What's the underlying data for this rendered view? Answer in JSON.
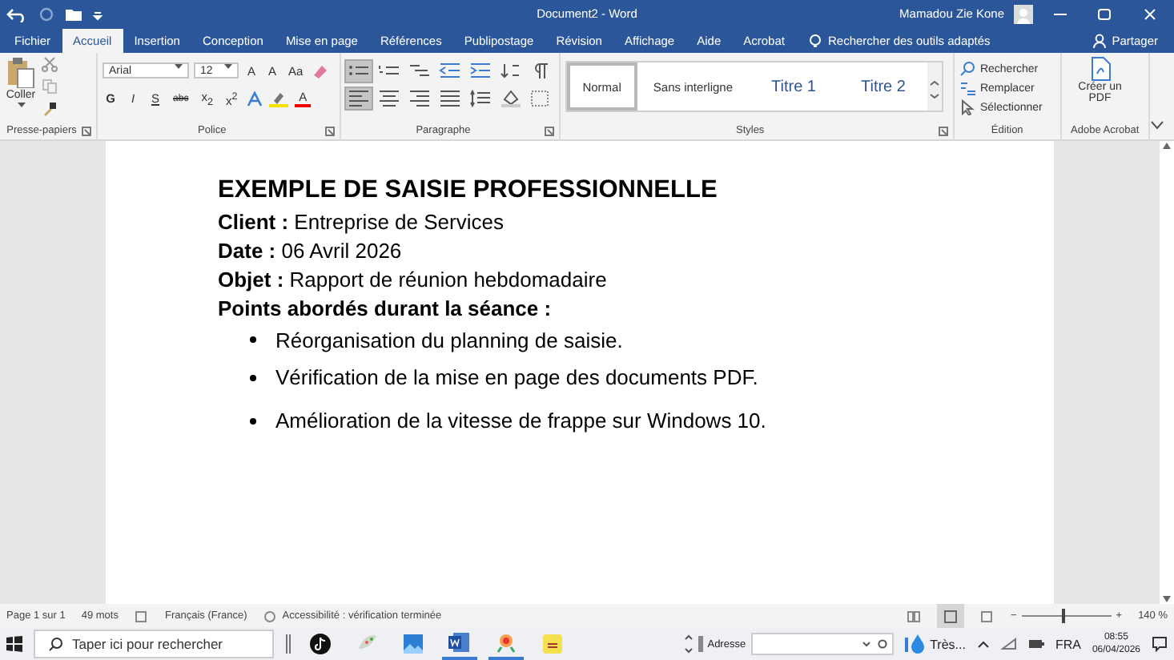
{
  "title_bar": {
    "title": "Document2 - Word",
    "user": "Mamadou Zie Kone"
  },
  "tabs": [
    {
      "label": "Fichier",
      "selected": false
    },
    {
      "label": "Accueil",
      "selected": true
    },
    {
      "label": "Insertion",
      "selected": false
    },
    {
      "label": "Conception",
      "selected": false
    },
    {
      "label": "Mise en page",
      "selected": false
    },
    {
      "label": "Références",
      "selected": false
    },
    {
      "label": "Publipostage",
      "selected": false
    },
    {
      "label": "Révision",
      "selected": false
    },
    {
      "label": "Affichage",
      "selected": false
    },
    {
      "label": "Aide",
      "selected": false
    },
    {
      "label": "Acrobat",
      "selected": false
    }
  ],
  "tell_me": {
    "placeholder": "Rechercher des outils adaptés"
  },
  "share": "Partager",
  "ribbon": {
    "clipboard": {
      "paste": "Coller",
      "group": "Presse-papiers"
    },
    "font": {
      "name": "Arial",
      "size": "12",
      "grow": "A",
      "shrink": "A",
      "case": "Aa",
      "buttons": [
        "G",
        "I",
        "S",
        "abc",
        "x$_{2}$",
        "x$^{2}$"
      ],
      "color_letter": "A",
      "group": "Police"
    },
    "paragraph": {
      "group": "Paragraphe",
      "buttons": [
        {
          "kind": "bullets",
          "on": true
        },
        {
          "kind": "numbers",
          "on": false
        },
        {
          "kind": "multilevel",
          "on": false
        },
        {
          "kind": "outdent",
          "on": false
        },
        {
          "kind": "indent",
          "on": false
        },
        {
          "kind": "sort",
          "on": false
        },
        {
          "kind": "pilcrow",
          "on": false
        },
        {
          "kind": "left",
          "on": true
        },
        {
          "kind": "center",
          "on": false
        },
        {
          "kind": "right",
          "on": false
        },
        {
          "kind": "justify",
          "on": false
        },
        {
          "kind": "spacing",
          "on": false
        },
        {
          "kind": "shading",
          "on": false
        },
        {
          "kind": "borders",
          "on": false
        }
      ]
    },
    "styles": {
      "group": "Styles",
      "items": [
        {
          "label": "Normal",
          "kind": "normal",
          "selected": true
        },
        {
          "label": "Sans interligne",
          "kind": "normal",
          "selected": false
        },
        {
          "label": "Titre 1",
          "kind": "heading",
          "selected": false
        },
        {
          "label": "Titre 2",
          "kind": "heading",
          "selected": false
        }
      ]
    },
    "editing": {
      "group": "Édition",
      "items": [
        {
          "label": "Rechercher",
          "kind": "find"
        },
        {
          "label": "Remplacer",
          "kind": "replace"
        },
        {
          "label": "Sélectionner",
          "kind": "select"
        }
      ]
    },
    "acrobat": {
      "group": "Adobe Acrobat",
      "button": "Créer un PDF"
    }
  },
  "document": {
    "heading": "EXEMPLE DE SAISIE PROFESSIONNELLE",
    "lines": [
      "**Client :** Entreprise de Services",
      "**Date :** 06 Avril 2026",
      "**Objet :** Rapport de réunion hebdomadaire",
      "**Points abordés durant la séance :**"
    ],
    "bullets": [
      "Réorganisation du planning de saisie.",
      "Vérification de la mise en page des documents PDF.",
      "Amélioration de la vitesse de frappe sur Windows 10."
    ]
  },
  "status_bar": {
    "page": "Page 1 sur 1",
    "words": "49 mots",
    "language": "Français (France)",
    "accessibility": "Accessibilité : vérification terminée",
    "zoom_minus": "−",
    "zoom_plus": "+",
    "zoom": "140 %",
    "level": 0.45
  },
  "taskbar": {
    "search": {
      "placeholder": "Taper ici pour rechercher"
    },
    "apps": [
      {
        "kind": "tiktok",
        "running": false
      },
      {
        "kind": "paint",
        "running": false
      },
      {
        "kind": "photos",
        "running": false
      },
      {
        "kind": "word",
        "running": true
      },
      {
        "kind": "tool",
        "running": true
      },
      {
        "kind": "notes",
        "running": false
      }
    ],
    "address_label": "Adresse",
    "weather": "Très...",
    "language": "FRA",
    "time": "08:55",
    "date": "06/04/2026"
  }
}
